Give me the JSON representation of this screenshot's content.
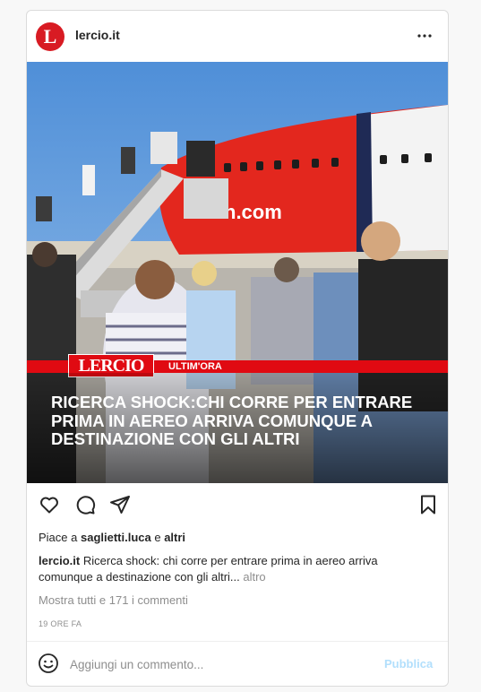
{
  "post": {
    "username": "lercio.it",
    "avatar_letter": "L",
    "image": {
      "banner_logo": "LERCIO",
      "banner_label": "ULTIM'ORA",
      "plane_livery_text": "n.com",
      "headline": "RICERCA SHOCK:CHI CORRE PER ENTRARE PRIMA IN AEREO ARRIVA COMUNQUE A DESTINAZIONE CON GLI ALTRI"
    },
    "likes": {
      "prefix": "Piace a ",
      "user": "saglietti.luca",
      "middle": " e ",
      "others": "altri"
    },
    "caption": {
      "username": "lercio.it",
      "text": " Ricerca shock: chi corre per entrare prima in aereo arriva comunque a destinazione con gli altri...",
      "more": " altro"
    },
    "comments_link": "Mostra tutti e 171 i commenti",
    "timestamp": "19 ORE FA",
    "comment_box": {
      "placeholder": "Aggiungi un commento...",
      "publish": "Pubblica"
    }
  },
  "icons": [
    "more-options-icon",
    "heart-icon",
    "comment-icon",
    "share-icon",
    "bookmark-icon",
    "emoji-icon"
  ],
  "colors": {
    "brand_red": "#e00a12",
    "avatar_red": "#d81b23",
    "publish_disabled": "#b2dffc",
    "muted_text": "#8e8e8e"
  }
}
